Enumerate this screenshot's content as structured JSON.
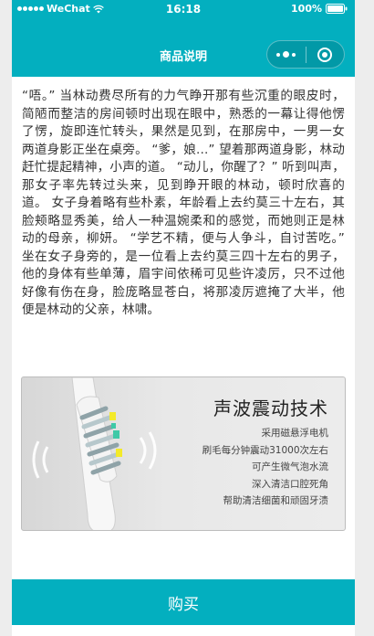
{
  "status_bar": {
    "carrier": "WeChat",
    "time": "16:18",
    "battery": "100%"
  },
  "nav": {
    "title": "商品说明"
  },
  "story": {
    "text": "“唔。” 当林动费尽所有的力气睁开那有些沉重的眼皮时，简陋而整洁的房间顿时出现在眼中，熟悉的一幕让得他愣了愣，旋即连忙转头，果然是见到，在那房中，一男一女两道身影正坐在桌旁。 “爹，娘...” 望着那两道身影，林动赶忙提起精神，小声的道。 “动儿，你醒了？” 听到叫声，那女子率先转过头来，见到睁开眼的林动，顿时欣喜的道。 女子身着略有些朴素，年龄看上去约莫三十左右，其脸颊略显秀美，给人一种温婉柔和的感觉，而她则正是林动的母亲，柳妍。 “学艺不精，便与人争斗，自讨苦吃。” 坐在女子身旁的，是一位看上去约莫三四十左右的男子，他的身体有些单薄，眉宇间依稀可见些许凌厉，只不过他好像有伤在身，脸庞略显苍白，将那凌厉遮掩了大半，他便是林动的父亲，林啸。"
  },
  "banner": {
    "title": "声波震动技术",
    "features": [
      "采用磁悬浮电机",
      "刷毛每分钟震动31000次左右",
      "可产生微气泡水流",
      "深入清洁口腔死角",
      "帮助清洁细菌和顽固牙渍"
    ],
    "image_icon": "toothbrush-icon",
    "accent_colors": [
      "#f3ea2a",
      "#3ec9a7"
    ]
  },
  "footer": {
    "buy_label": "购买"
  },
  "colors": {
    "primary": "#03afbf",
    "page_bg": "#ededed",
    "text": "#333333"
  }
}
